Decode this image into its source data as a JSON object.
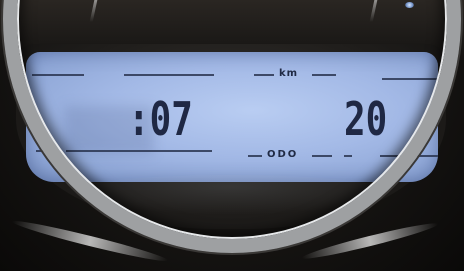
{
  "lcd": {
    "unit_top": "km",
    "unit_bottom": "ODO",
    "time_value": ":07",
    "odometer_value": "20",
    "backlight_color": "#a3b9e6",
    "segment_color": "#1f2844"
  },
  "bezel": {
    "ring_color": "#9ea0a2"
  }
}
